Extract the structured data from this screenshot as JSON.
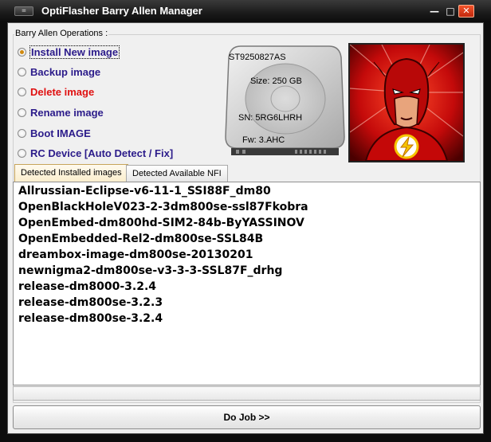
{
  "window": {
    "title": "OptiFlasher Barry Allen Manager",
    "icon_glyph": "=",
    "minimize_glyph": "—",
    "maximize_glyph": "□",
    "close_glyph": "✕"
  },
  "operations": {
    "group_label": "Barry Allen Operations :",
    "options": [
      {
        "label": "Install New image",
        "checked": true,
        "color": "#2b1b8a"
      },
      {
        "label": "Backup image",
        "checked": false,
        "color": "#2b1b8a"
      },
      {
        "label": "Delete image",
        "checked": false,
        "color": "#e01010"
      },
      {
        "label": "Rename image",
        "checked": false,
        "color": "#2b1b8a"
      },
      {
        "label": "Boot IMAGE",
        "checked": false,
        "color": "#2b1b8a"
      },
      {
        "label": "RC Device [Auto Detect / Fix]",
        "checked": false,
        "color": "#2b1b8a"
      }
    ]
  },
  "drive": {
    "model": "ST9250827AS",
    "size": "Size: 250 GB",
    "serial": "SN: 5RG6LHRH",
    "firmware": "Fw: 3.AHC"
  },
  "tabs": [
    {
      "label": "Detected Installed images",
      "active": true
    },
    {
      "label": "Detected Available NFI",
      "active": false
    }
  ],
  "images": [
    "Allrussian-Eclipse-v6-11-1_SSI88F_dm80",
    "OpenBlackHoleV023-2-3dm800se-ssl87Fkobra",
    "OpenEmbed-dm800hd-SIM2-84b-ByYASSINOV",
    "OpenEmbedded-Rel2-dm800se-SSL84B",
    "dreambox-image-dm800se-20130201",
    "newnigma2-dm800se-v3-3-3-SSL87F_drhg",
    "release-dm8000-3.2.4",
    "release-dm800se-3.2.3",
    "release-dm800se-3.2.4"
  ],
  "status_text": "",
  "actions": {
    "do_job": "Do Job >>"
  }
}
